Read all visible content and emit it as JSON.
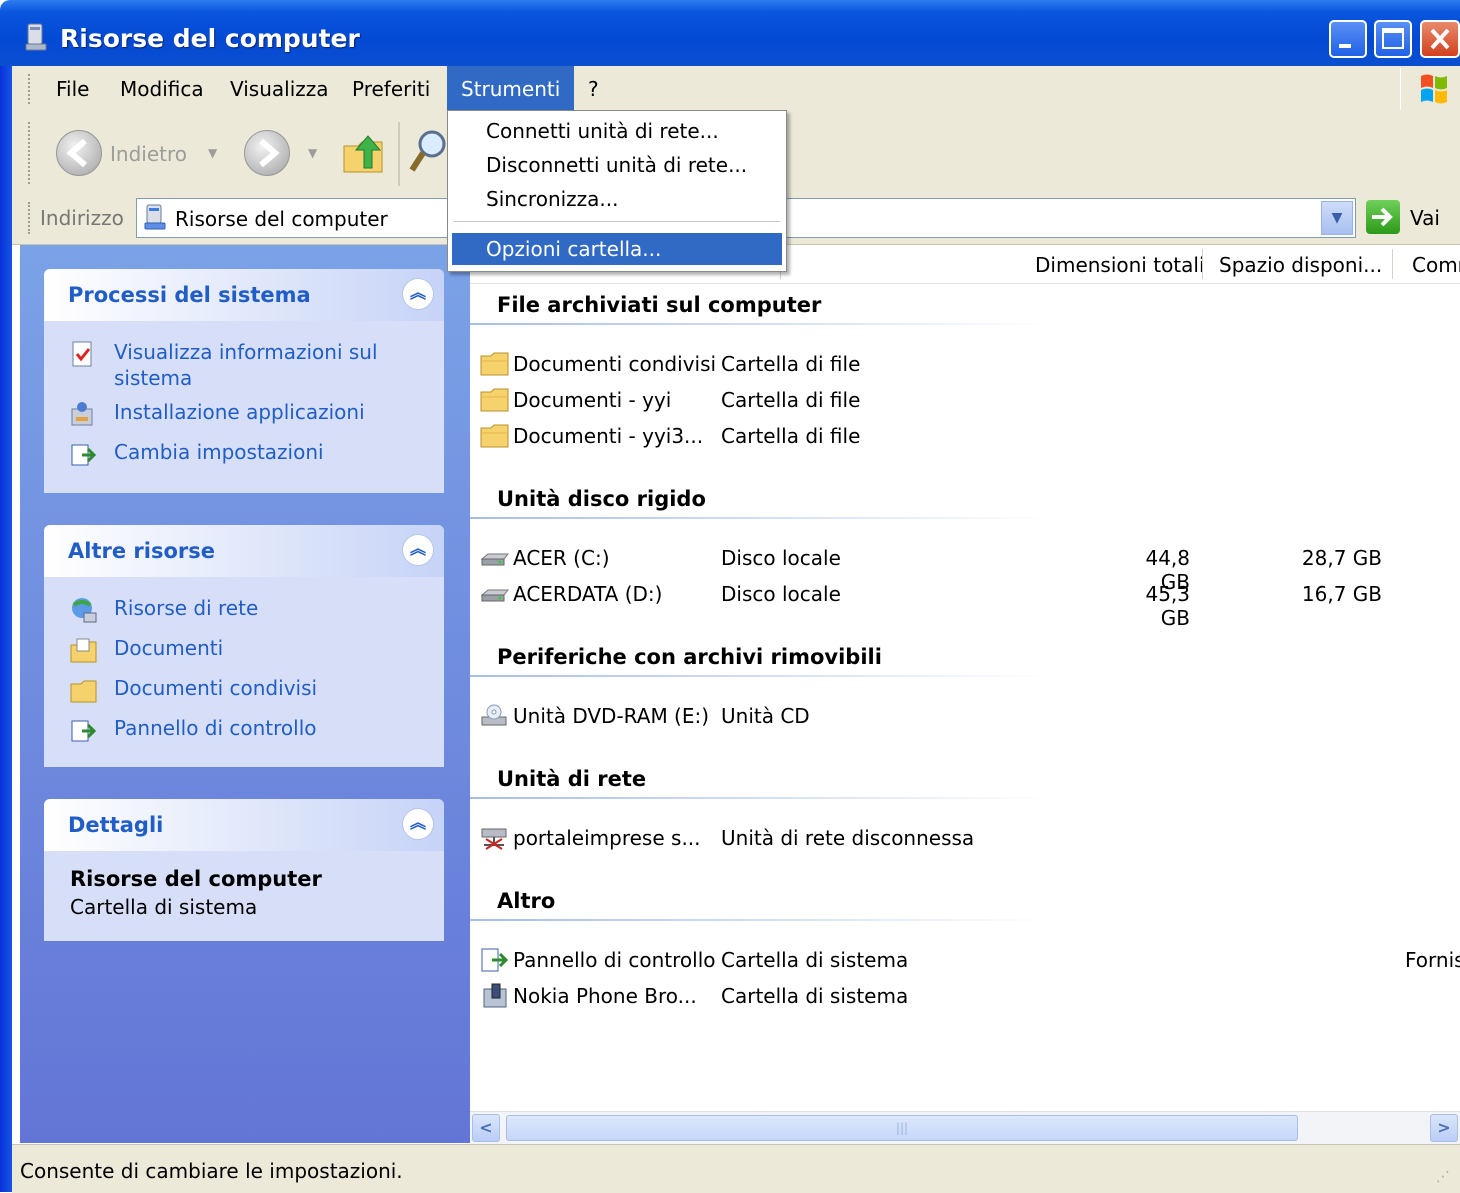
{
  "window": {
    "title": "Risorse del computer"
  },
  "menubar": {
    "items": [
      "File",
      "Modifica",
      "Visualizza",
      "Preferiti",
      "Strumenti",
      "?"
    ]
  },
  "toolbar": {
    "back_label": "Indietro"
  },
  "address": {
    "label": "Indirizzo",
    "value": "Risorse del computer",
    "go_label": "Vai"
  },
  "strumenti_menu": {
    "items": [
      "Connetti unità di rete...",
      "Disconnetti unità di rete...",
      "Sincronizza...",
      "Opzioni cartella..."
    ],
    "selected": "Opzioni cartella..."
  },
  "left_panels": {
    "system": {
      "title": "Processi del sistema",
      "links": [
        "Visualizza informazioni sul sistema",
        "Installazione applicazioni",
        "Cambia impostazioni"
      ]
    },
    "other": {
      "title": "Altre risorse",
      "links": [
        "Risorse di rete",
        "Documenti",
        "Documenti condivisi",
        "Pannello di controllo"
      ]
    },
    "details": {
      "title": "Dettagli",
      "name": "Risorse del computer",
      "type": "Cartella di sistema"
    }
  },
  "columns": [
    "Dimensioni totali",
    "Spazio disponi...",
    "Comn"
  ],
  "groups": [
    {
      "title": "File archiviati sul computer",
      "rows": [
        {
          "name": "Documenti condivisi",
          "type": "Cartella di file",
          "icon": "folder-icon"
        },
        {
          "name": "Documenti - yyi",
          "type": "Cartella di file",
          "icon": "folder-icon"
        },
        {
          "name": "Documenti - yyi3...",
          "type": "Cartella di file",
          "icon": "folder-icon"
        }
      ]
    },
    {
      "title": "Unità disco rigido",
      "rows": [
        {
          "name": "ACER (C:)",
          "type": "Disco locale",
          "size": "44,8 GB",
          "free": "28,7 GB",
          "icon": "hard-drive-icon"
        },
        {
          "name": "ACERDATA (D:)",
          "type": "Disco locale",
          "size": "45,3 GB",
          "free": "16,7 GB",
          "icon": "hard-drive-icon"
        }
      ]
    },
    {
      "title": "Periferiche con archivi rimovibili",
      "rows": [
        {
          "name": "Unità DVD-RAM (E:)",
          "type": "Unità CD",
          "icon": "dvd-drive-icon"
        }
      ]
    },
    {
      "title": "Unità di rete",
      "rows": [
        {
          "name": "portaleimprese s...",
          "type": "Unità di rete disconnessa",
          "icon": "network-drive-icon"
        }
      ]
    },
    {
      "title": "Altro",
      "rows": [
        {
          "name": "Pannello di controllo",
          "type": "Cartella di sistema",
          "comment": "Fornis",
          "icon": "control-panel-icon"
        },
        {
          "name": "Nokia Phone Bro...",
          "type": "Cartella di sistema",
          "icon": "phone-browser-icon"
        }
      ]
    }
  ],
  "statusbar": {
    "text": "Consente di cambiare le impostazioni."
  },
  "colors": {
    "titlebar": "#0349d4",
    "menu_highlight": "#316ac5",
    "panel_link": "#215dc6",
    "panel_bg": "#d6dff7"
  }
}
